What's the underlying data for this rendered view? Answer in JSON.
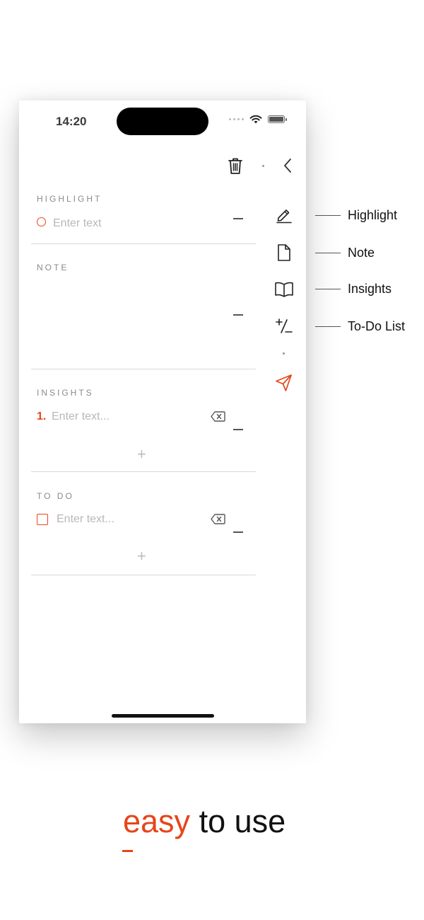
{
  "status_bar": {
    "time": "14:20"
  },
  "toolbar": {
    "delete_icon": "trash-icon",
    "back_icon": "chevron-left-icon"
  },
  "sections": {
    "highlight": {
      "title": "HIGHLIGHT",
      "placeholder": "Enter text"
    },
    "note": {
      "title": "NOTE"
    },
    "insights": {
      "title": "INSIGHTS",
      "item_number": "1.",
      "placeholder": "Enter text..."
    },
    "todo": {
      "title": "TO DO",
      "placeholder": "Enter text..."
    }
  },
  "sidebar": {
    "items": [
      {
        "icon": "pencil-icon",
        "label": "Highlight"
      },
      {
        "icon": "document-icon",
        "label": "Note"
      },
      {
        "icon": "book-icon",
        "label": "Insights"
      },
      {
        "icon": "plus-minus-icon",
        "label": "To-Do List"
      }
    ],
    "send_icon": "send-icon"
  },
  "tagline": {
    "accent": "easy",
    "rest": " to use"
  },
  "colors": {
    "accent": "#e5461b",
    "divider": "#d9d9d9",
    "placeholder": "#b8b8b8"
  }
}
